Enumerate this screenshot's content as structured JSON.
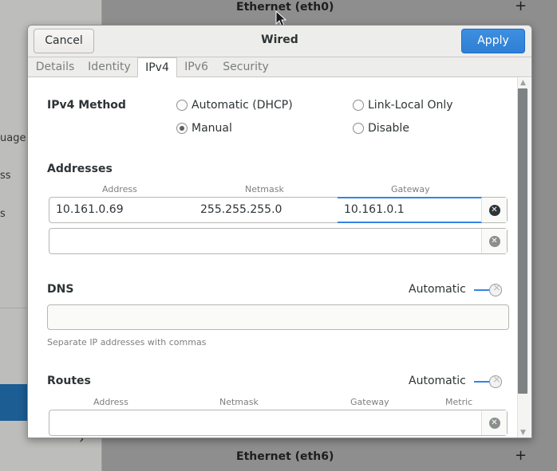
{
  "background": {
    "sidebar_fragments": [
      "uage",
      "ss",
      "s"
    ],
    "rows": [
      "Ethernet (eth0)",
      "Ethernet (eth6)"
    ],
    "plus_glyph": "+",
    "chevron_glyph": "›"
  },
  "dialog": {
    "title": "Wired",
    "cancel_label": "Cancel",
    "apply_label": "Apply",
    "tabs": [
      {
        "label": "Details",
        "active": false
      },
      {
        "label": "Identity",
        "active": false
      },
      {
        "label": "IPv4",
        "active": true
      },
      {
        "label": "IPv6",
        "active": false
      },
      {
        "label": "Security",
        "active": false
      }
    ],
    "ipv4_method": {
      "label": "IPv4 Method",
      "options": [
        {
          "label": "Automatic (DHCP)",
          "selected": false
        },
        {
          "label": "Link-Local Only",
          "selected": false
        },
        {
          "label": "Manual",
          "selected": true
        },
        {
          "label": "Disable",
          "selected": false
        }
      ]
    },
    "addresses": {
      "label": "Addresses",
      "columns": [
        "Address",
        "Netmask",
        "Gateway"
      ],
      "rows": [
        {
          "address": "10.161.0.69",
          "netmask": "255.255.255.0",
          "gateway": "10.161.0.1"
        },
        {
          "address": "",
          "netmask": "",
          "gateway": ""
        }
      ]
    },
    "dns": {
      "label": "DNS",
      "automatic_label": "Automatic",
      "automatic_on": false,
      "value": "",
      "hint": "Separate IP addresses with commas"
    },
    "routes": {
      "label": "Routes",
      "automatic_label": "Automatic",
      "automatic_on": false,
      "columns": [
        "Address",
        "Netmask",
        "Gateway",
        "Metric"
      ]
    }
  },
  "colors": {
    "accent": "#3584e4",
    "apply_button": "#2f7fd4",
    "selected_sidebar": "#1c5d93"
  },
  "icons": [
    "delete-icon",
    "mouse-cursor-icon",
    "radio-icon",
    "switch-off-icon"
  ]
}
